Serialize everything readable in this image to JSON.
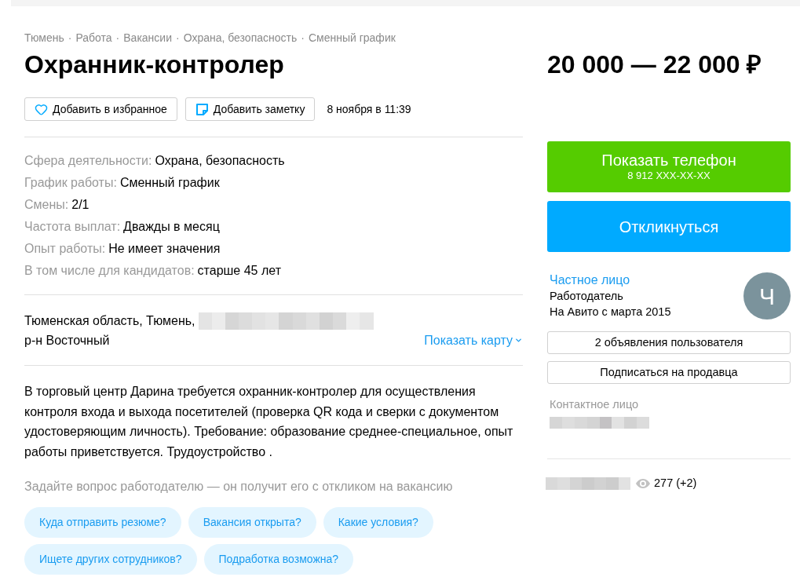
{
  "breadcrumbs": {
    "separator": "·",
    "items": [
      "Тюмень",
      "Работа",
      "Вакансии",
      "Охрана, безопасность",
      "Сменный график"
    ]
  },
  "title": "Охранник-контролер",
  "actions": [
    {
      "kind": "favorite",
      "label": "Добавить в избранное"
    },
    {
      "kind": "note",
      "label": "Добавить заметку"
    }
  ],
  "date": "8 ноября в 11:39",
  "properties": [
    {
      "label": "Сфера деятельности:",
      "value": "Охрана, безопасность"
    },
    {
      "label": "График работы:",
      "value": "Сменный график"
    },
    {
      "label": "Смены:",
      "value": "2/1"
    },
    {
      "label": "Частота выплат:",
      "value": "Дважды в месяц"
    },
    {
      "label": "Опыт работы:",
      "value": "Не имеет значения"
    },
    {
      "label": "В том числе для кандидатов:",
      "value": "старше 45 лет"
    }
  ],
  "address": {
    "line_1": "Тюменская область, Тюмень,",
    "line_2": "р-н Восточный",
    "map_link": "Показать карту"
  },
  "description": "В торговый центр Дарина требуется охранник-контролер для осуществления контроля входа и выхода посетителей (проверка QR кода и сверки с документом удостоверяющим личность). Требование: образование среднее-специальное, опыт работы приветствуется. Трудоустройство .",
  "questions": {
    "prompt": "Задайте вопрос работодателю — он получит его с откликом на вакансию",
    "chips": [
      [
        "Куда отправить резюме?",
        "Вакансия открыта?",
        "Какие условия?"
      ],
      [
        "Ищете других сотрудников?",
        "Подработка возможна?"
      ]
    ]
  },
  "sidebar": {
    "price": "20 000 — 22 000 ₽",
    "phone_button": {
      "label": "Показать телефон",
      "number": "8 912 XXX-XX-XX"
    },
    "respond_button": "Откликнуться",
    "seller": {
      "name": "Частное лицо",
      "role": "Работодатель",
      "since": "На Авито с марта 2015",
      "avatar_letter": "Ч"
    },
    "seller_buttons": [
      "2 объявления пользователя",
      "Подписаться на продавца"
    ],
    "contact_label": "Контактное лицо",
    "views": "277 (+2)"
  }
}
